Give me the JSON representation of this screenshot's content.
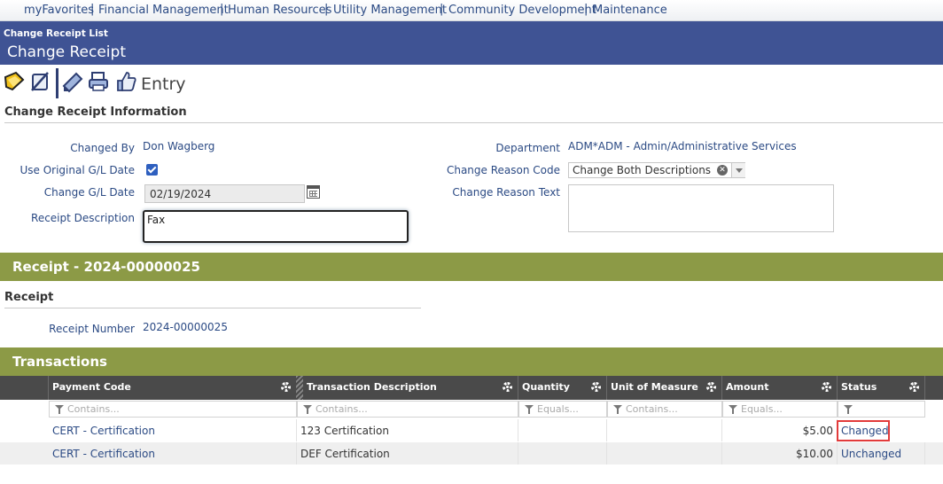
{
  "topnav": {
    "items": [
      "myFavorites",
      "Financial Management",
      "Human Resources",
      "Utility Management",
      "Community Development",
      "Maintenance"
    ],
    "separator": "|"
  },
  "header": {
    "breadcrumb": "Change Receipt List",
    "title": "Change Receipt"
  },
  "toolbar": {
    "buttons": [
      "edit-icon",
      "cancel-icon",
      "save-icon",
      "print-icon",
      "approve-icon"
    ],
    "mode": "Entry"
  },
  "info": {
    "section_title": "Change Receipt Information",
    "changed_by_label": "Changed By",
    "changed_by": "Don Wagberg",
    "use_original_label": "Use Original G/L Date",
    "use_original_checked": true,
    "change_gl_label": "Change G/L Date",
    "change_gl_date": "02/19/2024",
    "receipt_desc_label": "Receipt Description",
    "receipt_desc": "Fax",
    "department_label": "Department",
    "department": "ADM*ADM - Admin/Administrative Services",
    "reason_code_label": "Change Reason Code",
    "reason_code": "Change Both Descriptions",
    "reason_text_label": "Change Reason Text",
    "reason_text": ""
  },
  "receipt_band": "Receipt - 2024-00000025",
  "receipt": {
    "section_title": "Receipt",
    "number_label": "Receipt Number",
    "number": "2024-00000025"
  },
  "transactions_band": "Transactions",
  "grid": {
    "columns": [
      "Payment Code",
      "Transaction Description",
      "Quantity",
      "Unit of Measure",
      "Amount",
      "Status"
    ],
    "filters": [
      "Contains...",
      "Contains...",
      "Equals...",
      "Contains...",
      "Equals...",
      ""
    ],
    "rows": [
      {
        "payment_code": "CERT - Certification",
        "description": "123 Certification",
        "quantity": "",
        "uom": "",
        "amount": "$5.00",
        "status": "Changed"
      },
      {
        "payment_code": "CERT - Certification",
        "description": "DEF Certification",
        "quantity": "",
        "uom": "",
        "amount": "$10.00",
        "status": "Unchanged"
      }
    ]
  },
  "colors": {
    "header_blue": "#3f5394",
    "band_olive": "#8c9a46",
    "link_blue": "#2b4a84",
    "highlight_red": "#e23b3b"
  }
}
